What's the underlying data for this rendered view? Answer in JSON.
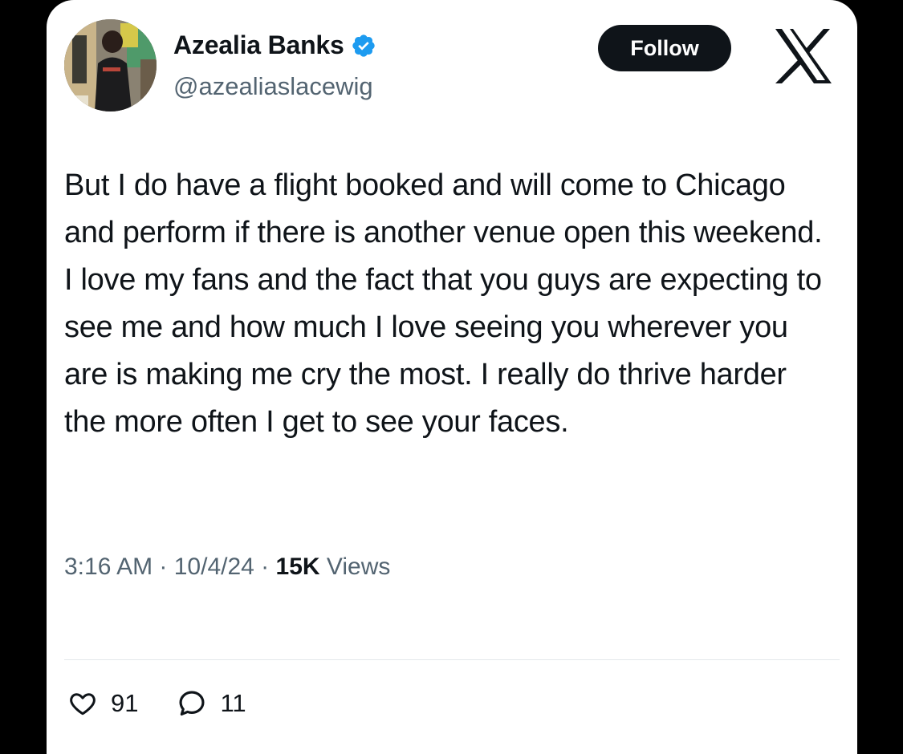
{
  "author": {
    "display_name": "Azealia Banks",
    "handle": "@azealiaslacewig",
    "verified": true
  },
  "follow_button": {
    "label": "Follow"
  },
  "logo": {
    "icon": "x-logo-icon"
  },
  "tweet": {
    "text": "But I do have a flight booked and will come to Chicago and perform if there is another venue open this weekend. I love my fans and the fact that you guys are expecting to see me and how much I love seeing you wherever you are is making me cry the most. I really do thrive harder the more often I get to see your faces.",
    "time": "3:16 AM",
    "date": "10/4/24",
    "views_count": "15K",
    "views_label": "Views"
  },
  "actions": {
    "likes": "91",
    "replies": "11"
  },
  "colors": {
    "background": "#000000",
    "card": "#ffffff",
    "text": "#0f1419",
    "secondary_text": "#536471",
    "verified_badge": "#1d9bf0"
  }
}
